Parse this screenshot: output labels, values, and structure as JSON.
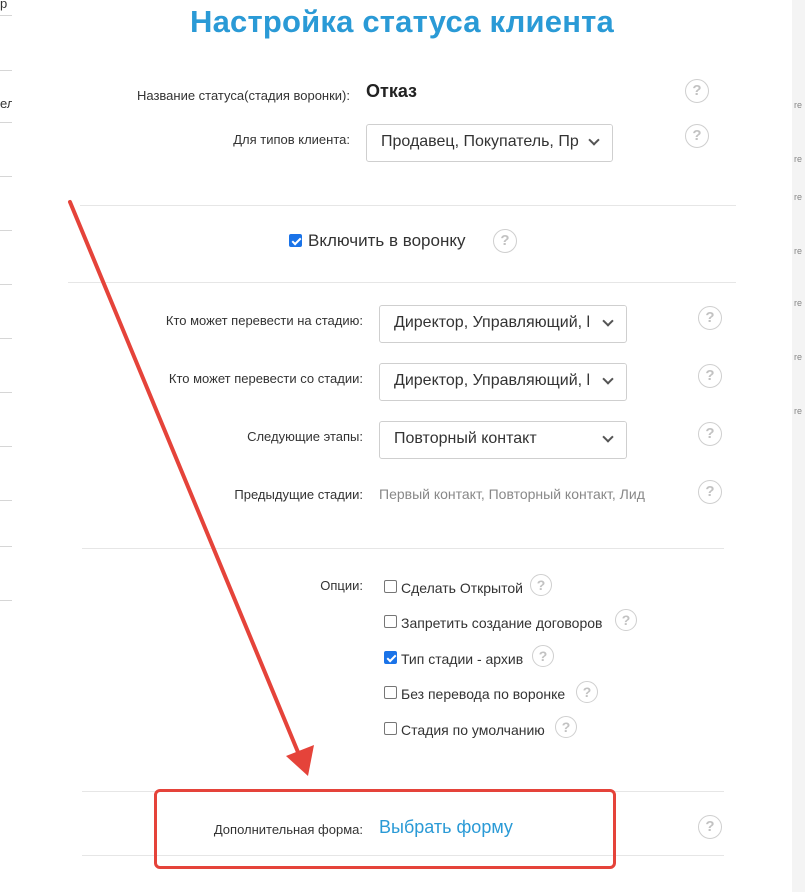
{
  "modal": {
    "title": "Настройка статуса клиента",
    "status_name_label": "Название статуса(стадия воронки):",
    "status_name_value": "Отказ",
    "client_types_label": "Для типов клиента:",
    "client_types_value": "Продавец, Покупатель, Пр",
    "include_funnel_label": "Включить в воронку",
    "include_funnel_checked": true,
    "who_to_label": "Кто может перевести на стадию:",
    "who_to_value": "Директор, Управляющий, l",
    "who_from_label": "Кто может перевести со стадии:",
    "who_from_value": "Директор, Управляющий, l",
    "next_stages_label": "Следующие этапы:",
    "next_stages_value": "Повторный контакт",
    "prev_stages_label": "Предыдущие стадии:",
    "prev_stages_value": "Первый контакт, Повторный контакт, Лид",
    "options_label": "Опции:",
    "options": [
      {
        "label": "Сделать Открытой",
        "checked": false
      },
      {
        "label": "Запретить создание договоров",
        "checked": false
      },
      {
        "label": "Тип стадии - архив",
        "checked": true
      },
      {
        "label": "Без перевода по воронке",
        "checked": false
      },
      {
        "label": "Стадия по умолчанию",
        "checked": false
      }
    ],
    "extra_form_label": "Дополнительная форма:",
    "extra_form_link": "Выбрать форму",
    "help_glyph": "?"
  },
  "background": {
    "left_fragments": [
      "р",
      "ел"
    ],
    "right_fragment": "re"
  },
  "colors": {
    "accent": "#2a9ad6",
    "annotation_red": "#e5433a",
    "checkbox_checked": "#1a73e8"
  }
}
